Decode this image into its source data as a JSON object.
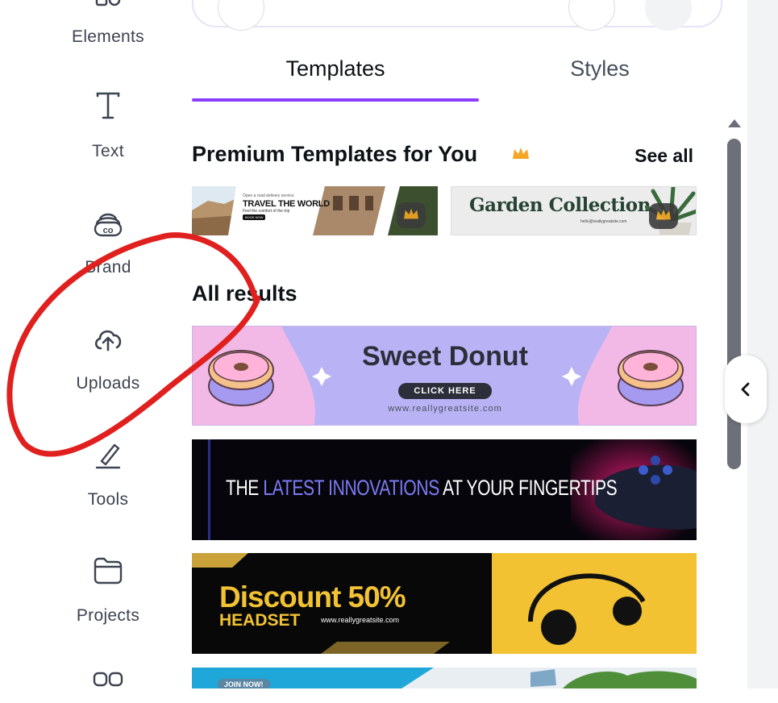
{
  "sidebar": {
    "items": [
      {
        "label": "Elements",
        "icon": "elements-icon"
      },
      {
        "label": "Text",
        "icon": "text-icon"
      },
      {
        "label": "Brand",
        "icon": "brand-icon"
      },
      {
        "label": "Uploads",
        "icon": "cloud-upload-icon"
      },
      {
        "label": "Tools",
        "icon": "tools-icon"
      },
      {
        "label": "Projects",
        "icon": "folder-icon"
      }
    ]
  },
  "tabs": [
    {
      "label": "Templates",
      "active": true
    },
    {
      "label": "Styles",
      "active": false
    }
  ],
  "premium": {
    "title": "Premium Templates for You",
    "see_all": "See all",
    "templates": [
      {
        "small": "Open a road delivery service",
        "headline": "TRAVEL THE WORLD",
        "sub": "Feel the comfort of the trip",
        "cta": "BOOK NOW"
      },
      {
        "headline": "Garden Collection",
        "sub": "hello@reallygreatsite.com"
      }
    ]
  },
  "results": {
    "title": "All results",
    "templates": [
      {
        "headline": "Sweet Donut",
        "cta": "CLICK HERE",
        "url": "www.reallygreatsite.com"
      },
      {
        "pre": "THE ",
        "highlight": "LATEST INNOVATIONS",
        "post": " AT YOUR FINGERTIPS"
      },
      {
        "headline": "Discount 50%",
        "sub": "HEADSET",
        "url": "www.reallygreatsite.com"
      },
      {
        "cta": "JOIN NOW!"
      }
    ]
  },
  "colors": {
    "accent": "#8b3dff",
    "crown": "#f5a623",
    "annotation": "#e0201e"
  }
}
